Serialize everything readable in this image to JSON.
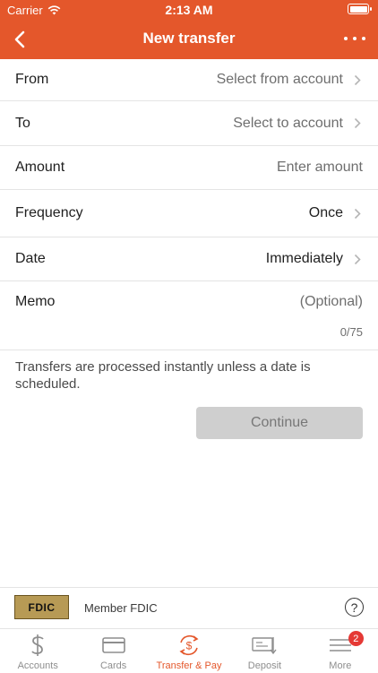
{
  "status_bar": {
    "carrier": "Carrier",
    "time": "2:13 AM"
  },
  "header": {
    "title": "New transfer"
  },
  "form": {
    "from": {
      "label": "From",
      "value": "Select from account"
    },
    "to": {
      "label": "To",
      "value": "Select to account"
    },
    "amount": {
      "label": "Amount",
      "placeholder": "Enter amount"
    },
    "frequency": {
      "label": "Frequency",
      "value": "Once"
    },
    "date": {
      "label": "Date",
      "value": "Immediately"
    },
    "memo": {
      "label": "Memo",
      "placeholder": "(Optional)",
      "counter": "0/75"
    }
  },
  "notice": "Transfers are processed instantly unless a date is scheduled.",
  "continue_label": "Continue",
  "fdic": {
    "logo_text": "FDIC",
    "member_text": "Member FDIC"
  },
  "tabs": [
    {
      "label": "Accounts",
      "icon": "dollar-icon",
      "active": false
    },
    {
      "label": "Cards",
      "icon": "card-icon",
      "active": false
    },
    {
      "label": "Transfer & Pay",
      "icon": "transfer-icon",
      "active": true
    },
    {
      "label": "Deposit",
      "icon": "check-deposit-icon",
      "active": false
    },
    {
      "label": "More",
      "icon": "menu-icon",
      "active": false,
      "badge": "2"
    }
  ],
  "colors": {
    "accent": "#e4572b",
    "badge": "#e53935",
    "button_disabled": "#cfcfcf"
  }
}
